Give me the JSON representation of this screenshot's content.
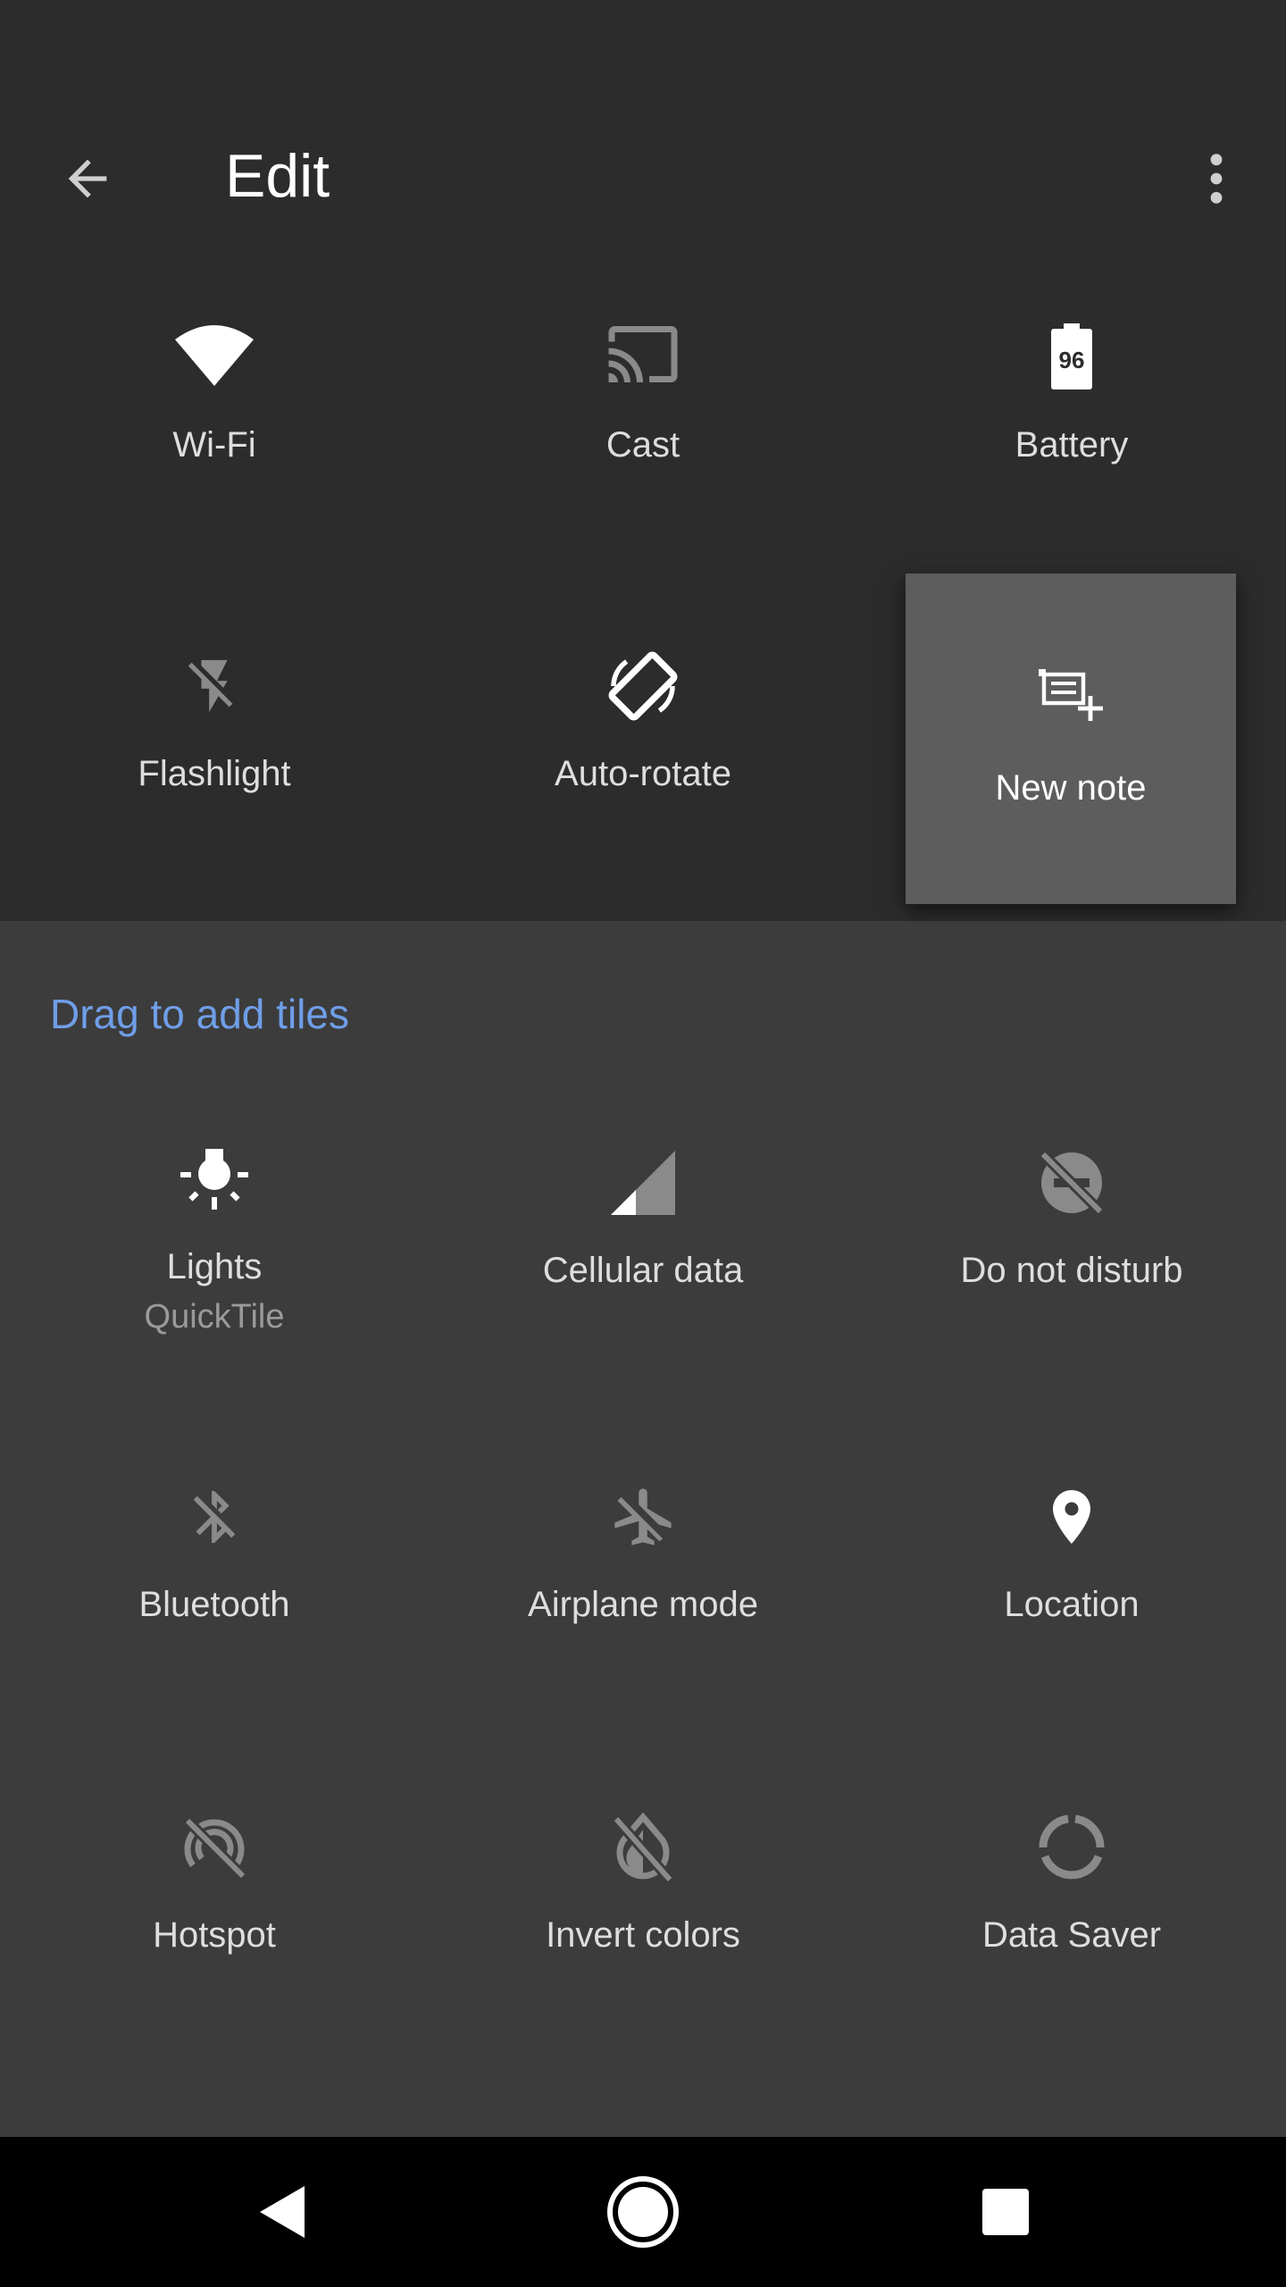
{
  "header": {
    "title": "Edit",
    "back_icon": "arrow-back-icon",
    "more_icon": "more-vert-icon"
  },
  "active_tiles": [
    {
      "label": "Wi-Fi",
      "icon": "wifi-icon"
    },
    {
      "label": "Cast",
      "icon": "cast-icon"
    },
    {
      "label": "Battery",
      "icon": "battery-icon",
      "value": "96"
    },
    {
      "label": "Flashlight",
      "icon": "flashlight-off-icon"
    },
    {
      "label": "Auto-rotate",
      "icon": "auto-rotate-icon"
    },
    {
      "label": "New note",
      "icon": "new-note-icon"
    }
  ],
  "add_section": {
    "heading": "Drag to add tiles"
  },
  "available_tiles": [
    {
      "label": "Lights",
      "sublabel": "QuickTile",
      "icon": "lights-icon"
    },
    {
      "label": "Cellular data",
      "icon": "cellular-signal-icon"
    },
    {
      "label": "Do not disturb",
      "icon": "do-not-disturb-off-icon"
    },
    {
      "label": "Bluetooth",
      "icon": "bluetooth-off-icon"
    },
    {
      "label": "Airplane mode",
      "icon": "airplane-off-icon"
    },
    {
      "label": "Location",
      "icon": "location-pin-icon"
    },
    {
      "label": "Hotspot",
      "icon": "hotspot-off-icon"
    },
    {
      "label": "Invert colors",
      "icon": "invert-colors-off-icon"
    },
    {
      "label": "Data Saver",
      "icon": "data-saver-icon"
    }
  ],
  "navbar": {
    "back_icon": "nav-back-icon",
    "home_icon": "nav-home-icon",
    "recents_icon": "nav-recents-icon"
  },
  "colors": {
    "accent": "#6f9ee8",
    "background_active": "#2c2c2d",
    "background_add": "#3c3c3d",
    "selected_tile": "#5d5d5e",
    "navbar": "#000000"
  }
}
